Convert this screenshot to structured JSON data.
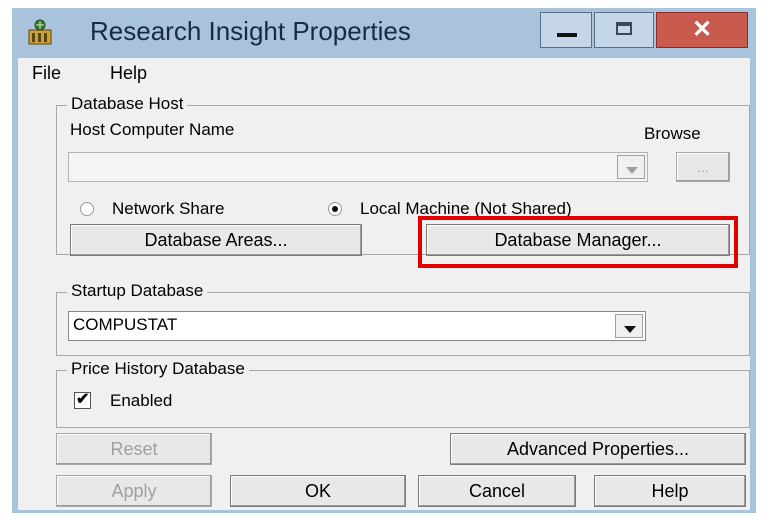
{
  "window": {
    "title": "Research Insight Properties"
  },
  "menu": {
    "file": "File",
    "help": "Help"
  },
  "database_host": {
    "group_label": "Database Host",
    "host_label": "Host Computer Name",
    "browse_label": "Browse",
    "browse_button": "...",
    "host_value": "",
    "radio_network": "Network Share",
    "radio_local": "Local Machine (Not Shared)",
    "selected_option": "Local Machine (Not Shared)",
    "areas_button": "Database Areas...",
    "manager_button": "Database Manager..."
  },
  "startup": {
    "group_label": "Startup Database",
    "value": "COMPUSTAT"
  },
  "price_history": {
    "group_label": "Price History Database",
    "checkbox_label": "Enabled",
    "checked": true
  },
  "buttons": {
    "reset": "Reset",
    "advanced": "Advanced Properties...",
    "apply": "Apply",
    "ok": "OK",
    "cancel": "Cancel",
    "help": "Help"
  },
  "highlight_color": "#e00000",
  "icons": {
    "app": "app-icon",
    "minimize": "minimize-icon",
    "maximize": "maximize-icon",
    "close": "close-icon",
    "dropdown": "chevron-down-icon"
  }
}
